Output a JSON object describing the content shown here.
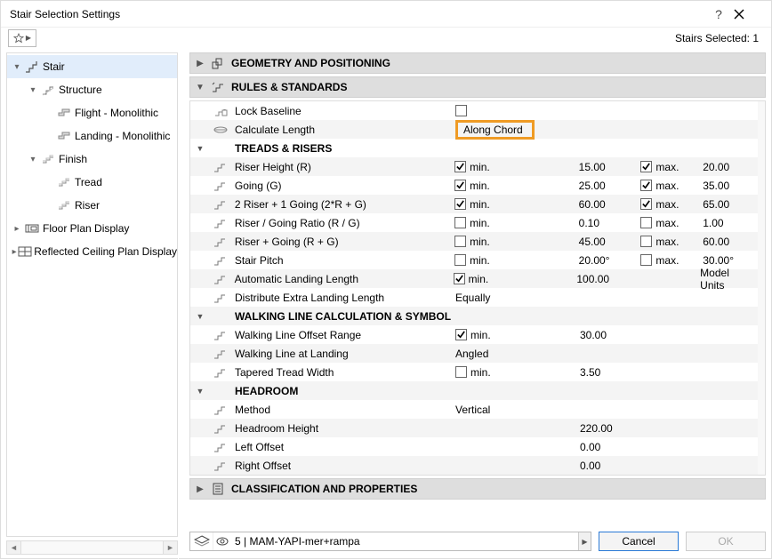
{
  "title": "Stair Selection Settings",
  "stairs_selected_label": "Stairs Selected: 1",
  "sidebar": {
    "items": [
      {
        "label": "Stair",
        "depth": 0,
        "arrow": "▾",
        "sel": true,
        "icon": "stair"
      },
      {
        "label": "Structure",
        "depth": 1,
        "arrow": "▾",
        "sel": false,
        "icon": "structure"
      },
      {
        "label": "Flight - Monolithic",
        "depth": 2,
        "arrow": "",
        "sel": false,
        "icon": "block"
      },
      {
        "label": "Landing - Monolithic",
        "depth": 2,
        "arrow": "",
        "sel": false,
        "icon": "block"
      },
      {
        "label": "Finish",
        "depth": 1,
        "arrow": "▾",
        "sel": false,
        "icon": "finish"
      },
      {
        "label": "Tread",
        "depth": 2,
        "arrow": "",
        "sel": false,
        "icon": "finish"
      },
      {
        "label": "Riser",
        "depth": 2,
        "arrow": "",
        "sel": false,
        "icon": "finish"
      },
      {
        "label": "Floor Plan Display",
        "depth": 0,
        "arrow": "▸",
        "sel": false,
        "icon": "floor"
      },
      {
        "label": "Reflected Ceiling Plan Display",
        "depth": 0,
        "arrow": "▸",
        "sel": false,
        "icon": "ceiling"
      }
    ]
  },
  "sections": {
    "geometry": "GEOMETRY AND POSITIONING",
    "rules": "RULES & STANDARDS",
    "classification": "CLASSIFICATION AND PROPERTIES"
  },
  "rules": {
    "lock_baseline": {
      "label": "Lock Baseline",
      "checked": false
    },
    "calc_length": {
      "label": "Calculate Length",
      "value": "Along Chord"
    },
    "treads_header": "TREADS & RISERS",
    "treads": [
      {
        "label": "Riser Height (R)",
        "minChk": true,
        "minVal": "15.00",
        "maxChk": true,
        "maxVal": "20.00"
      },
      {
        "label": "Going (G)",
        "minChk": true,
        "minVal": "25.00",
        "maxChk": true,
        "maxVal": "35.00"
      },
      {
        "label": "2 Riser + 1 Going (2*R + G)",
        "minChk": true,
        "minVal": "60.00",
        "maxChk": true,
        "maxVal": "65.00"
      },
      {
        "label": "Riser / Going Ratio (R / G)",
        "minChk": false,
        "minVal": "0.10",
        "maxChk": false,
        "maxVal": "1.00"
      },
      {
        "label": "Riser + Going (R + G)",
        "minChk": false,
        "minVal": "45.00",
        "maxChk": false,
        "maxVal": "60.00"
      },
      {
        "label": "Stair Pitch",
        "minChk": false,
        "minVal": "20.00°",
        "maxChk": false,
        "maxVal": "30.00°"
      },
      {
        "label": "Automatic Landing Length",
        "minChk": true,
        "minVal": "100.00",
        "maxNote": "Model Units"
      },
      {
        "label": "Distribute Extra Landing Length",
        "val1": "Equally"
      }
    ],
    "walk_header": "WALKING LINE CALCULATION & SYMBOL",
    "walk": [
      {
        "label": "Walking Line Offset Range",
        "minChk": true,
        "minVal": "30.00"
      },
      {
        "label": "Walking Line at Landing",
        "val1": "Angled"
      },
      {
        "label": "Tapered Tread Width",
        "minChk": false,
        "minVal": "3.50"
      }
    ],
    "head_header": "HEADROOM",
    "head": [
      {
        "label": "Method",
        "val1": "Vertical"
      },
      {
        "label": "Headroom Height",
        "num": "220.00"
      },
      {
        "label": "Left Offset",
        "num": "0.00"
      },
      {
        "label": "Right Offset",
        "num": "0.00"
      }
    ]
  },
  "labels": {
    "min": "min.",
    "max": "max."
  },
  "footer": {
    "layer": "5 | MAM-YAPI-mer+rampa",
    "cancel": "Cancel",
    "ok": "OK"
  }
}
